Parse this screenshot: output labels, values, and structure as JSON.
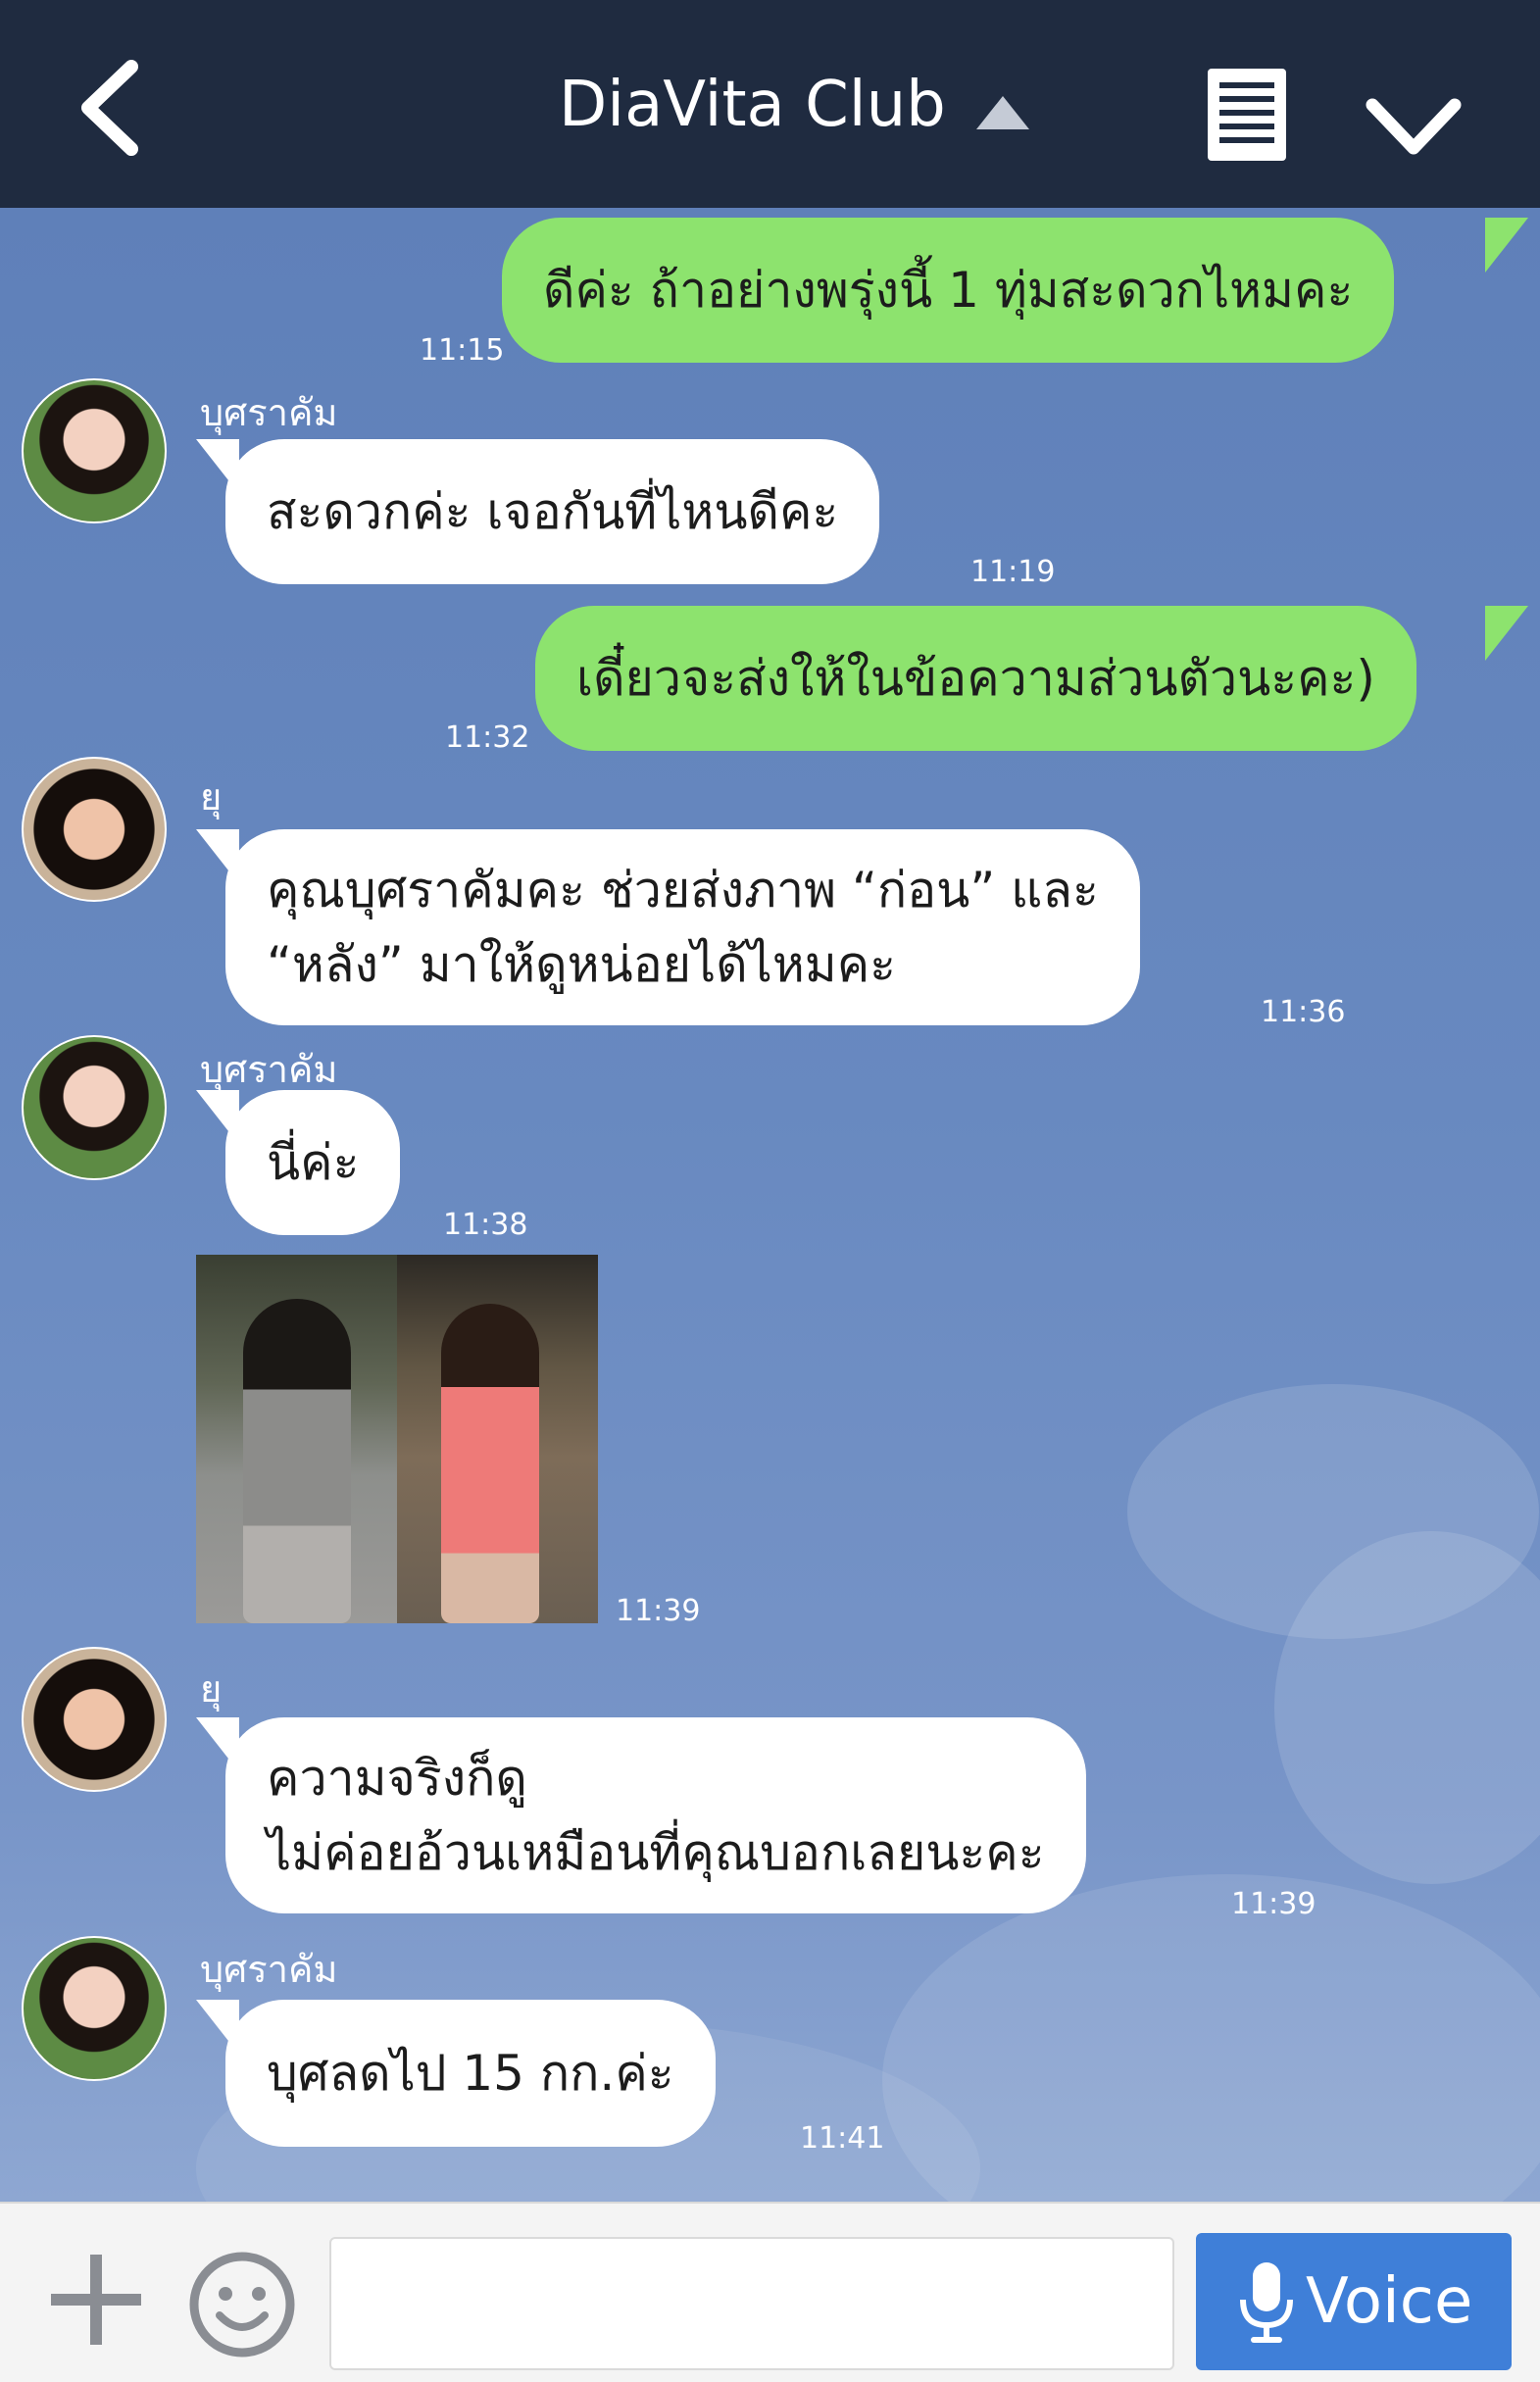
{
  "header": {
    "title": "DiaVita Club",
    "icons": [
      "back-icon",
      "title-arrow-up-icon",
      "notes-icon",
      "chevron-down-icon"
    ]
  },
  "messages": [
    {
      "side": "out",
      "text": "ดีค่ะ ถ้าอย่างพรุ่งนี้ 1 ทุ่มสะดวกไหมคะ",
      "time": "11:15"
    },
    {
      "side": "in",
      "sender": "บุศราคัม",
      "text": "สะดวกค่ะ เจอกันที่ไหนดีคะ",
      "time": "11:19"
    },
    {
      "side": "out",
      "text": "เดี๋ยวจะส่งให้ในข้อความส่วนตัวนะคะ)",
      "time": "11:32"
    },
    {
      "side": "in",
      "sender": "ยุ",
      "lines": [
        "คุณบุศราคัมคะ ช่วยส่งภาพ “ก่อน” และ",
        "“หลัง” มาให้ดูหน่อยได้ไหมคะ"
      ],
      "time": "11:36"
    },
    {
      "side": "in",
      "sender": "บุศราคัม",
      "text": "นี่ค่ะ",
      "time": "11:38"
    },
    {
      "side": "in",
      "type": "image",
      "time": "11:39"
    },
    {
      "side": "in",
      "sender": "ยุ",
      "lines": [
        "ความจริงก็ดู",
        "ไม่ค่อยอ้วนเหมือนที่คุณบอกเลยนะคะ"
      ],
      "time": "11:39"
    },
    {
      "side": "in",
      "sender": "บุศราคัม",
      "text": "บุศลดไป 15 กก.ค่ะ",
      "time": "11:41"
    }
  ],
  "input": {
    "placeholder": "",
    "voice_label": "Voice",
    "icons": [
      "plus-icon",
      "smile-icon",
      "mic-icon"
    ]
  },
  "colors": {
    "header_bg": "#1f2b40",
    "outgoing_bubble": "#8de36e",
    "incoming_bubble": "#ffffff",
    "chat_bg": "#6a8cc4",
    "voice_button": "#3f7fd8"
  }
}
